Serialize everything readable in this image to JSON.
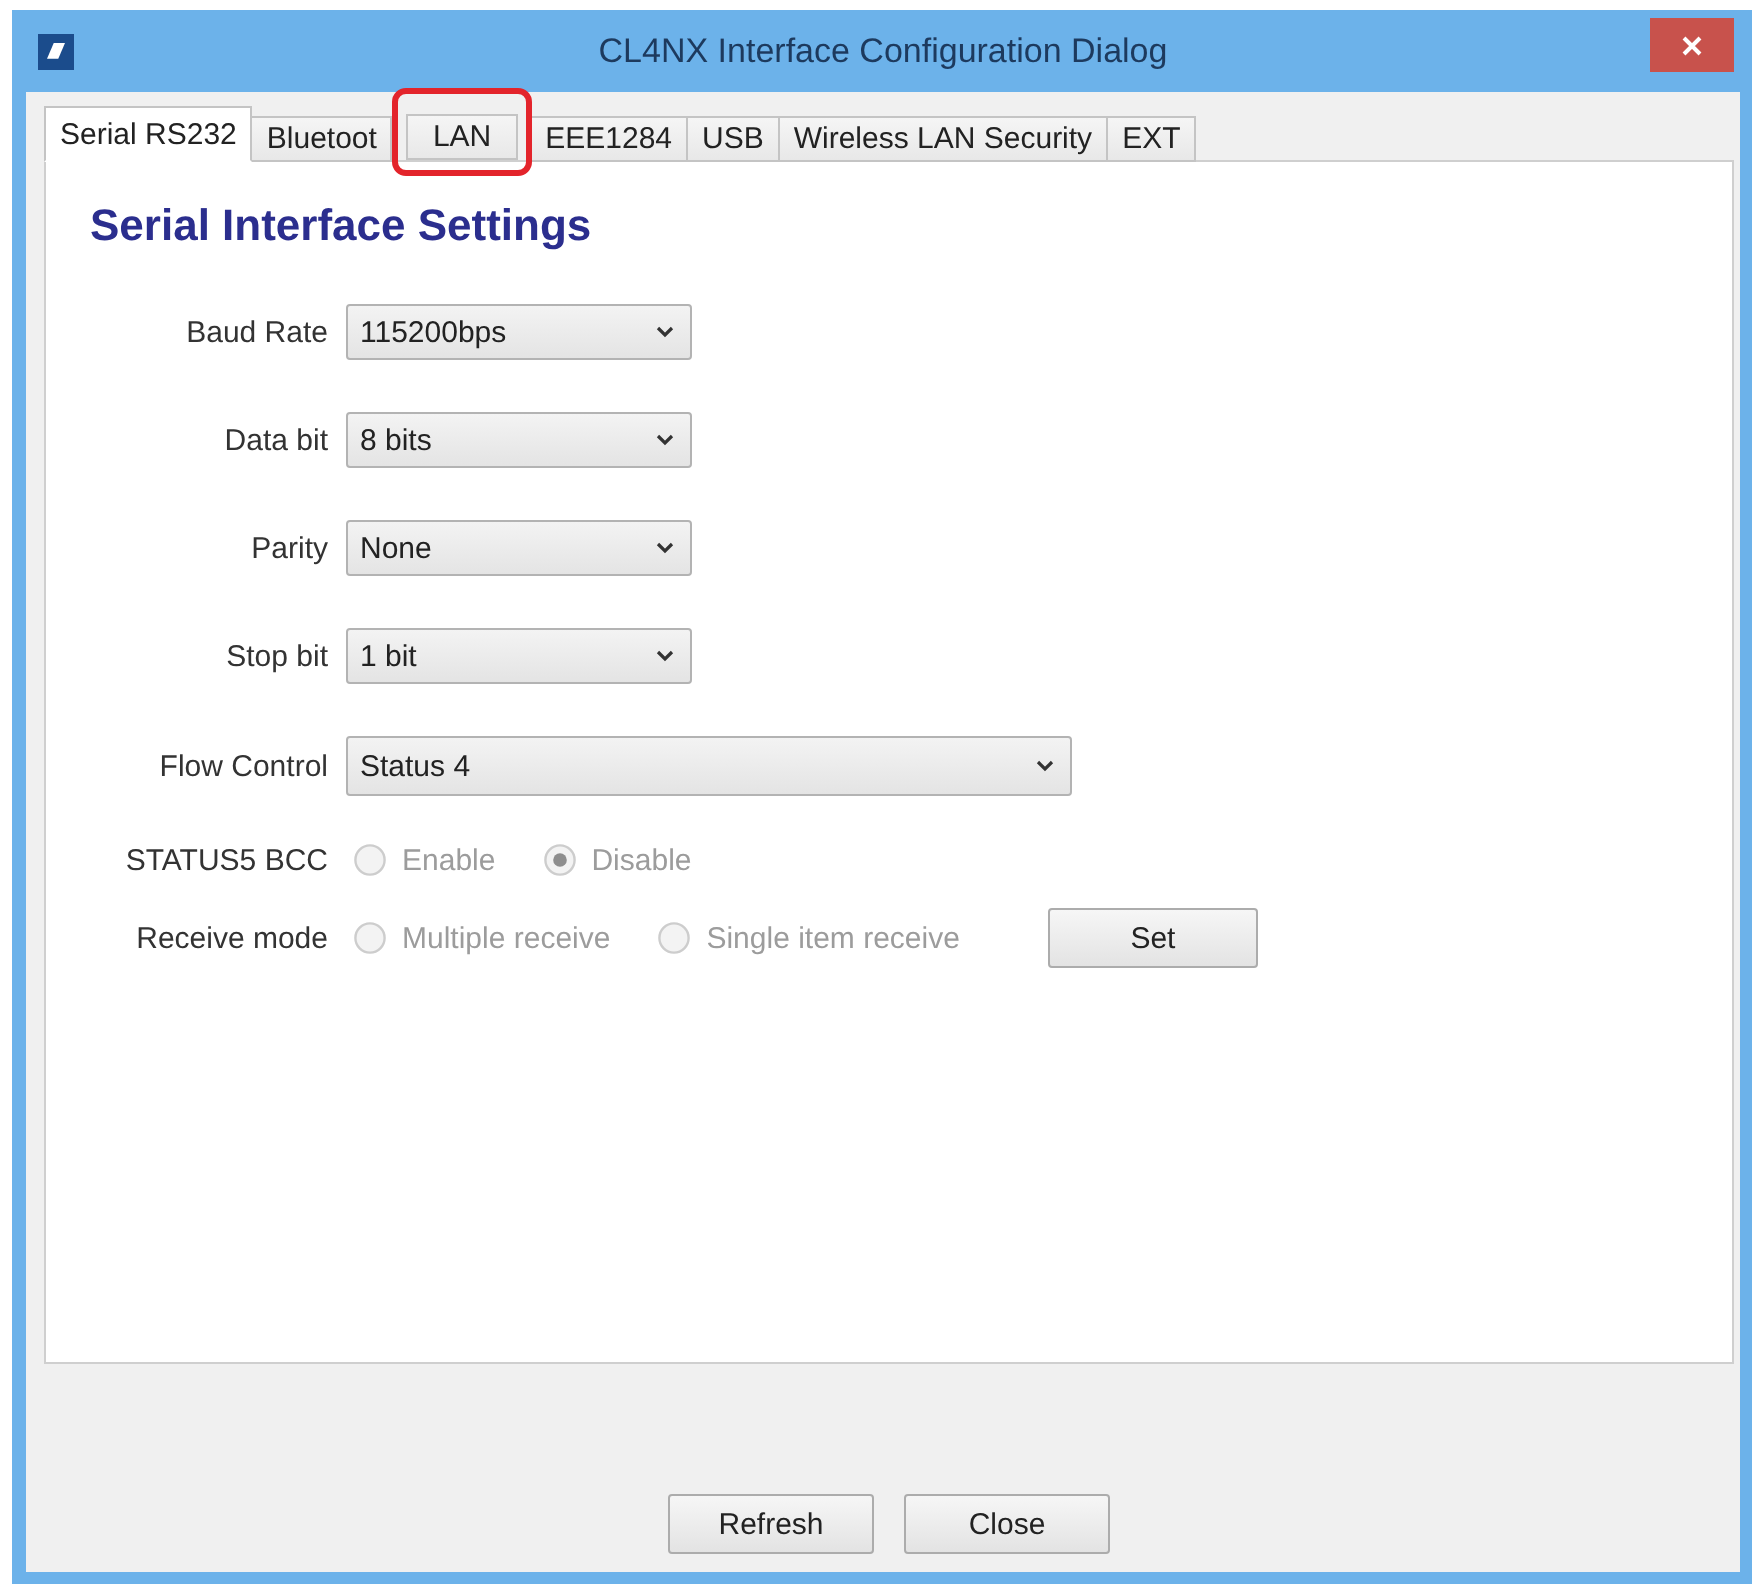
{
  "window": {
    "title": "CL4NX Interface Configuration Dialog"
  },
  "tabs": [
    {
      "label": "Serial RS232",
      "selected": true,
      "highlighted": false
    },
    {
      "label": "Bluetoot",
      "selected": false,
      "highlighted": false
    },
    {
      "label": "LAN",
      "selected": false,
      "highlighted": true
    },
    {
      "label": "EEE1284",
      "selected": false,
      "highlighted": false
    },
    {
      "label": "USB",
      "selected": false,
      "highlighted": false
    },
    {
      "label": "Wireless LAN Security",
      "selected": false,
      "highlighted": false
    },
    {
      "label": "EXT",
      "selected": false,
      "highlighted": false
    }
  ],
  "panel": {
    "heading": "Serial Interface Settings",
    "rows": [
      {
        "kind": "select",
        "label": "Baud Rate",
        "value": "115200bps",
        "wide": false
      },
      {
        "kind": "select",
        "label": "Data bit",
        "value": "8 bits",
        "wide": false
      },
      {
        "kind": "select",
        "label": "Parity",
        "value": "None",
        "wide": false
      },
      {
        "kind": "select",
        "label": "Stop bit",
        "value": "1 bit",
        "wide": false
      },
      {
        "kind": "select",
        "label": "Flow Control",
        "value": "Status 4",
        "wide": true
      },
      {
        "kind": "radio",
        "label": "STATUS5 BCC",
        "disabled": true,
        "options": [
          {
            "label": "Enable",
            "selected": false
          },
          {
            "label": "Disable",
            "selected": true
          }
        ]
      },
      {
        "kind": "radio",
        "label": "Receive mode",
        "disabled": true,
        "options": [
          {
            "label": "Multiple receive",
            "selected": false
          },
          {
            "label": "Single item receive",
            "selected": false
          }
        ],
        "button": "Set"
      }
    ]
  },
  "buttons": [
    "Refresh",
    "Close"
  ]
}
